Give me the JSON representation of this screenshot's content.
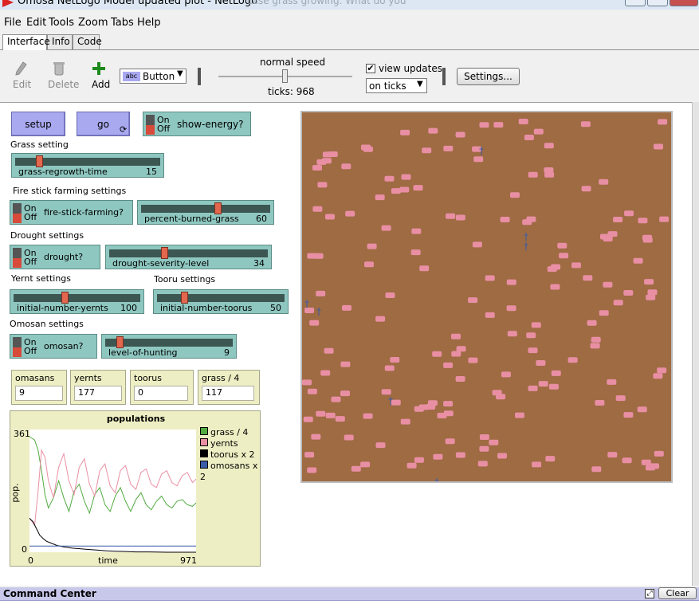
{
  "window": {
    "title": "Omosa NetLogo Model updated plot - NetLogo",
    "ghost_text": "case grass growing.  What do you"
  },
  "menu": [
    "File",
    "Edit",
    "Tools",
    "Zoom",
    "Tabs",
    "Help"
  ],
  "tabs": [
    "Interface",
    "Info",
    "Code"
  ],
  "toolbar": {
    "edit_label": "Edit",
    "delete_label": "Delete",
    "add_label": "Add",
    "widget_type": "Button",
    "widget_type_icon": "abc",
    "speed_label": "normal speed",
    "speed_level": 0.5,
    "ticks_label": "ticks: 968",
    "view_updates_label": "view updates",
    "view_updates_checked": true,
    "update_mode": "on ticks",
    "settings_label": "Settings..."
  },
  "widgets": {
    "setup_label": "setup",
    "go_label": "go",
    "on": "On",
    "off": "Off",
    "show_energy": "show-energy?",
    "grass_setting": "Grass setting",
    "grass_regrowth": {
      "label": "grass-regrowth-time",
      "value": "15",
      "min": 0,
      "max": 100,
      "level": 0.15
    },
    "fire_setting": "Fire stick farming settings",
    "fire_switch": "fire-stick-farming?",
    "burned": {
      "label": "percent-burned-grass",
      "value": "60",
      "level": 0.6
    },
    "drought_setting": "Drought settings",
    "drought_switch": "drought?",
    "drought_level": {
      "label": "drought-severity-level",
      "value": "34",
      "level": 0.34
    },
    "yernt_setting": "Yernt settings",
    "tooru_setting": "Tooru settings",
    "yernts": {
      "label": "initial-number-yernts",
      "value": "100",
      "level": 0.4
    },
    "toorus": {
      "label": "initial-number-toorus",
      "value": "50",
      "level": 0.2
    },
    "omosan_setting": "Omosan settings",
    "omosan_switch": "omosan?",
    "hunting": {
      "label": "level-of-hunting",
      "value": "9",
      "level": 0.09
    }
  },
  "monitors": [
    {
      "label": "omasans",
      "value": "9"
    },
    {
      "label": "yernts",
      "value": "177"
    },
    {
      "label": "toorus",
      "value": "0"
    },
    {
      "label": "grass / 4",
      "value": "117"
    }
  ],
  "command_center": {
    "title": "Command Center",
    "clear_label": "Clear"
  },
  "colors": {
    "grass": "#52ab40",
    "yernt": "#e98fa4",
    "tooru": "#000000",
    "omosan": "#3b5ca8",
    "ground": "#9e6b43",
    "button": "#a9a9f0",
    "teal": "#8ec7c0"
  },
  "chart_data": {
    "type": "line",
    "title": "populations",
    "ylabel": "pop.",
    "xlabel": "time",
    "xlim": [
      0,
      971
    ],
    "ylim": [
      0,
      361
    ],
    "x_ticks": [
      "0",
      "971"
    ],
    "y_ticks": [
      "361",
      "0"
    ],
    "legend_position": "right",
    "series": [
      {
        "name": "grass / 4",
        "color": "#52ab40",
        "x": [
          0,
          30,
          50,
          70,
          90,
          110,
          140,
          170,
          200,
          230,
          260,
          290,
          320,
          350,
          380,
          410,
          440,
          470,
          500,
          530,
          560,
          590,
          620,
          650,
          680,
          710,
          740,
          770,
          800,
          830,
          860,
          890,
          920,
          950,
          971
        ],
        "y": [
          340,
          330,
          300,
          240,
          170,
          130,
          160,
          210,
          160,
          120,
          180,
          200,
          150,
          115,
          170,
          190,
          140,
          120,
          165,
          190,
          150,
          120,
          155,
          175,
          140,
          125,
          150,
          165,
          140,
          130,
          150,
          155,
          140,
          135,
          145
        ]
      },
      {
        "name": "yernts",
        "color": "#e98fa4",
        "x": [
          0,
          30,
          50,
          70,
          90,
          110,
          140,
          170,
          200,
          230,
          260,
          290,
          320,
          350,
          380,
          410,
          440,
          470,
          500,
          530,
          560,
          590,
          620,
          650,
          680,
          710,
          740,
          770,
          800,
          830,
          860,
          890,
          920,
          950,
          971
        ],
        "y": [
          100,
          80,
          180,
          300,
          280,
          210,
          160,
          250,
          290,
          210,
          170,
          250,
          275,
          200,
          165,
          240,
          260,
          195,
          175,
          240,
          255,
          200,
          185,
          235,
          245,
          200,
          190,
          230,
          240,
          205,
          195,
          225,
          235,
          205,
          215
        ]
      },
      {
        "name": "toorus x 2",
        "color": "#000000",
        "x": [
          0,
          20,
          40,
          60,
          80,
          100,
          130,
          160,
          200,
          250,
          300,
          350,
          400,
          450,
          500,
          560,
          620,
          700,
          800,
          900,
          971
        ],
        "y": [
          100,
          90,
          70,
          50,
          40,
          32,
          26,
          20,
          16,
          12,
          10,
          8,
          6,
          4,
          3,
          2,
          1,
          1,
          0,
          0,
          0
        ]
      },
      {
        "name": "omosans x 2",
        "color": "#3b5ca8",
        "x": [
          0,
          971
        ],
        "y": [
          18,
          18
        ]
      }
    ]
  }
}
